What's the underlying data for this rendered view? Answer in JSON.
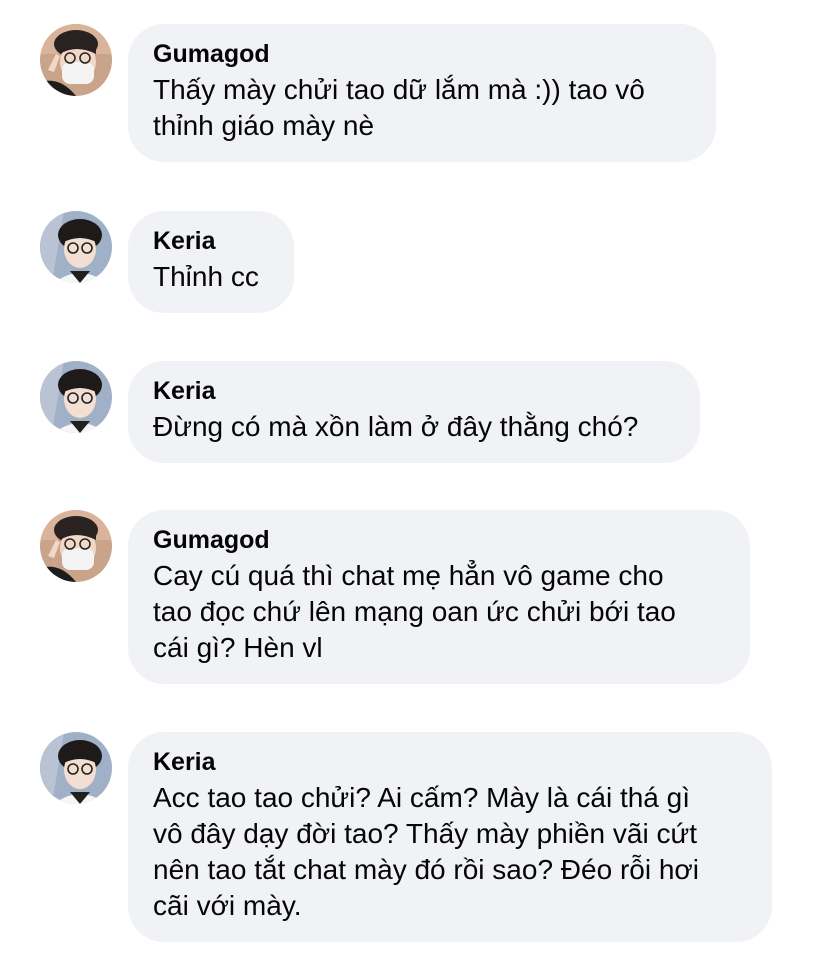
{
  "comments": [
    {
      "author": "Gumagod",
      "text": "Thấy mày chửi tao dữ lắm mà :)) tao vô\nthỉnh giáo mày nè",
      "avatar": "gumagod-avatar"
    },
    {
      "author": "Keria",
      "text": "Thỉnh cc",
      "avatar": "keria-avatar"
    },
    {
      "author": "Keria",
      "text": "Đừng có mà xồn làm ở đây thằng chó?",
      "avatar": "keria-avatar"
    },
    {
      "author": "Gumagod",
      "text": "Cay cú quá thì chat mẹ hẳn vô game cho\ntao đọc chứ lên mạng oan ức chửi bới tao\ncái gì? Hèn vl",
      "avatar": "gumagod-avatar"
    },
    {
      "author": "Keria",
      "text": "Acc tao tao chửi? Ai cấm? Mày là cái thá gì\nvô đây dạy đời tao? Thấy mày phiền vãi cứt\nnên tao tắt chat mày đó rồi sao? Đéo rỗi hơi\ncãi với mày.",
      "avatar": "keria-avatar"
    }
  ],
  "colors": {
    "bubble": "#f0f2f5",
    "text": "#050505"
  }
}
